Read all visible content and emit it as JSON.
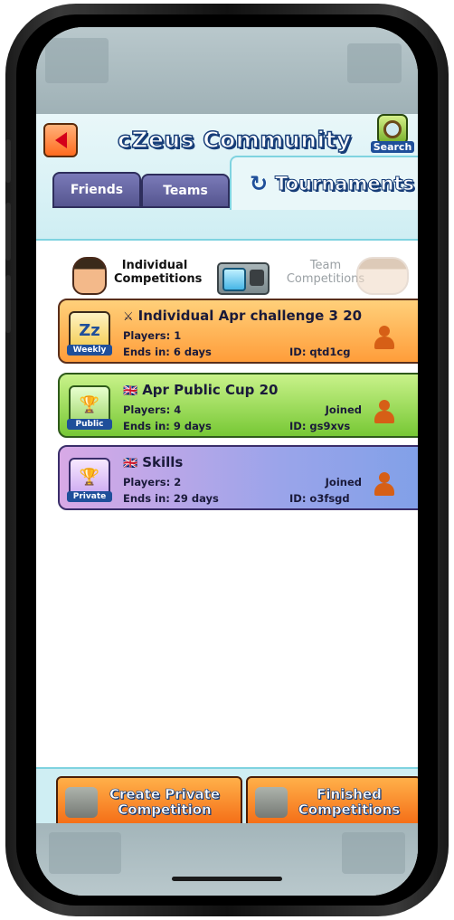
{
  "header": {
    "title": "cZeus Community",
    "search_label": "Search"
  },
  "tabs": [
    {
      "label": "Friends"
    },
    {
      "label": "Teams"
    },
    {
      "label": "Tournaments"
    }
  ],
  "segment": {
    "left_label": "Individual Competitions",
    "right_label": "Team Competitions"
  },
  "cards": [
    {
      "icon": "zz-icon",
      "badge": "Weekly",
      "title": "Individual Apr challenge 3 20",
      "players": "Players: 1",
      "ends": "Ends in: 6 days",
      "joined": "",
      "id": "ID: qtd1cg",
      "color": "#ff9d3a"
    },
    {
      "icon": "trophy-icon",
      "badge": "Public",
      "title": "Apr Public Cup 20",
      "players": "Players: 4",
      "ends": "Ends in: 9 days",
      "joined": "Joined",
      "id": "ID: gs9xvs",
      "color": "#77c835"
    },
    {
      "icon": "trophy-icon",
      "badge": "Private",
      "title": "Skills",
      "players": "Players: 2",
      "ends": "Ends in: 29 days",
      "joined": "Joined",
      "id": "ID: o3fsgd",
      "color": "#9aa4ea"
    }
  ],
  "actions": {
    "create_label": "Create Private Competition",
    "finished_label": "Finished Competitions"
  },
  "colors": {
    "accent_blue": "#1f4f9a",
    "panel_bg": "#e9f7f9",
    "orange": "#ff9d3a",
    "green": "#77c835",
    "purple": "#9aa4ea"
  }
}
